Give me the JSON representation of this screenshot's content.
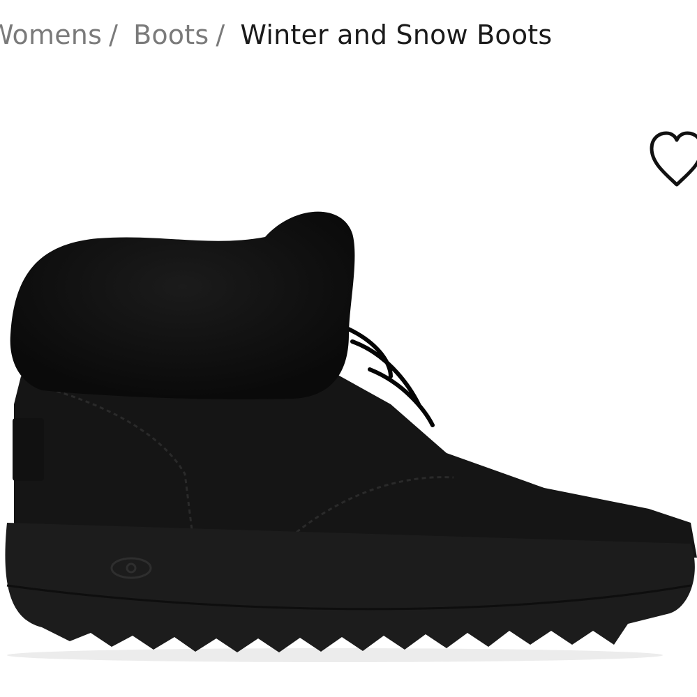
{
  "breadcrumb": {
    "items": [
      "Womens",
      "Boots"
    ],
    "separator": "/",
    "current": "Winter and Snow Boots"
  },
  "icons": {
    "wishlist": "heart-outline-icon"
  },
  "product": {
    "image_subject": "black faux-fur-cuff lace-up ankle boot"
  },
  "colors": {
    "breadcrumb_link": "#7a7a7a",
    "breadcrumb_current": "#1a1a1a",
    "product": "#141414"
  }
}
